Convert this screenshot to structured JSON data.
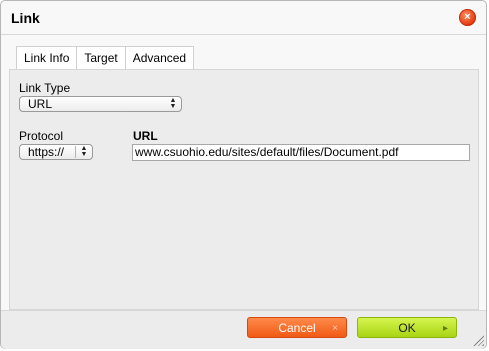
{
  "dialog": {
    "title": "Link",
    "close_icon": "×"
  },
  "tabs": [
    {
      "label": "Link Info",
      "active": true
    },
    {
      "label": "Target",
      "active": false
    },
    {
      "label": "Advanced",
      "active": false
    }
  ],
  "link_info": {
    "link_type_label": "Link Type",
    "link_type_value": "URL",
    "protocol_label": "Protocol",
    "protocol_value": "https://",
    "url_label": "URL",
    "url_value": "www.csuohio.edu/sites/default/files/Document.pdf"
  },
  "buttons": {
    "cancel_label": "Cancel",
    "cancel_icon": "×",
    "ok_label": "OK",
    "ok_icon": "▸"
  },
  "colors": {
    "cancel": "#f15a16",
    "ok": "#a8d412",
    "close": "#e2370f"
  }
}
